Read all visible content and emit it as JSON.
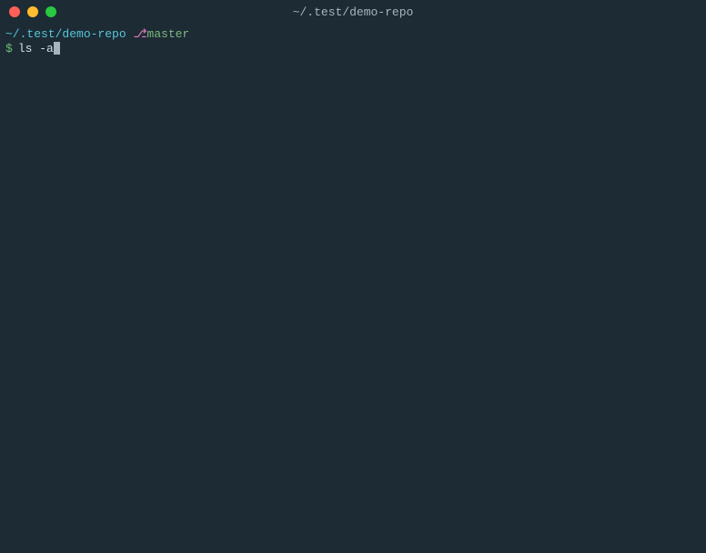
{
  "window": {
    "title": "~/.test/demo-repo"
  },
  "prompt": {
    "cwd": "~/.test/demo-repo",
    "separator": " ",
    "branch_icon": "⎇",
    "branch": "master",
    "symbol": "$",
    "command": "ls -a"
  },
  "colors": {
    "bg": "#1c2b34",
    "cwd": "#58c4dc",
    "branch_icon": "#e77cc1",
    "branch": "#7fb77e",
    "prompt": "#6fbf73",
    "text": "#d8dee4"
  }
}
